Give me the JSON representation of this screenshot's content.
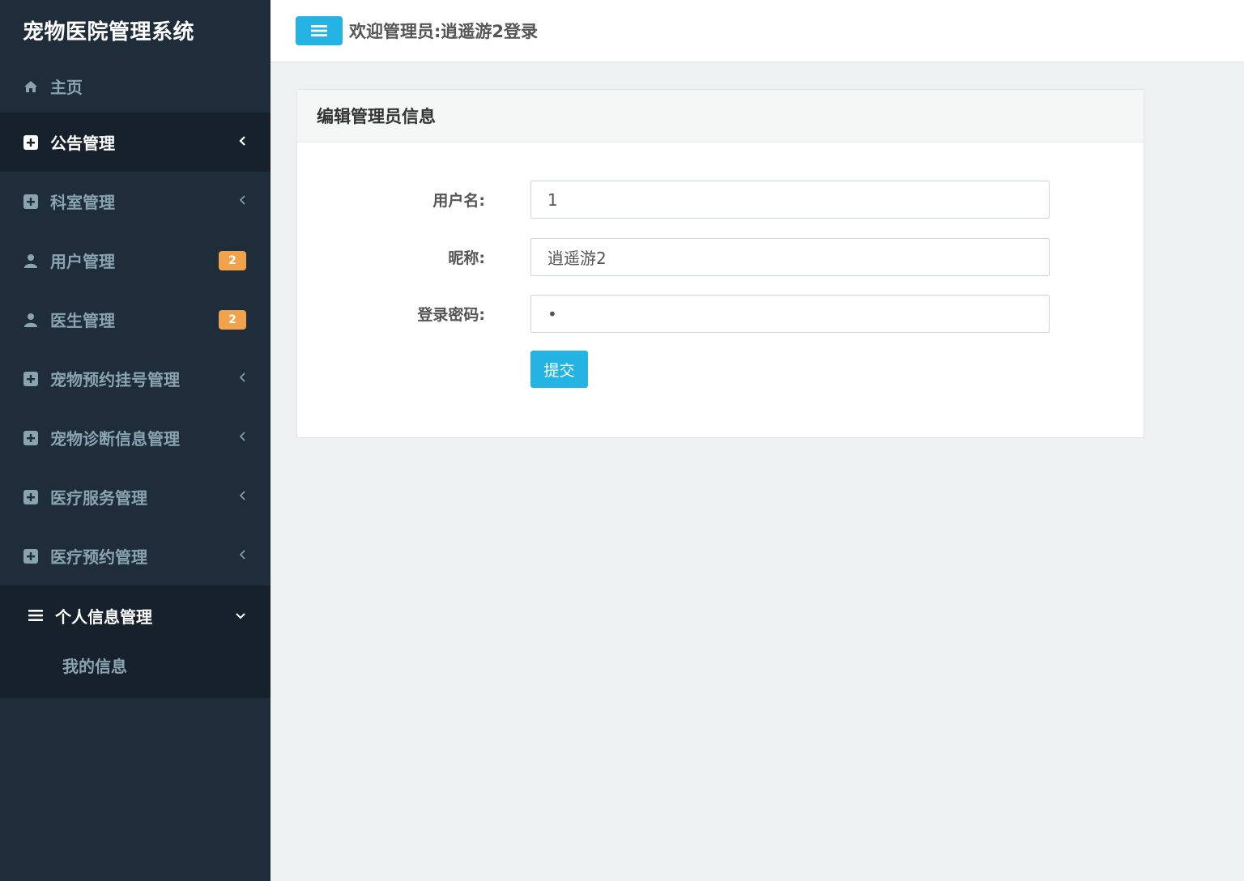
{
  "app": {
    "title": "宠物医院管理系统"
  },
  "sidebar": {
    "items": [
      {
        "label": "主页",
        "icon": "home-icon"
      },
      {
        "label": "公告管理",
        "icon": "plus-square-icon",
        "active": true
      },
      {
        "label": "科室管理",
        "icon": "plus-square-icon"
      },
      {
        "label": "用户管理",
        "icon": "user-icon",
        "badge": "2"
      },
      {
        "label": "医生管理",
        "icon": "user-icon",
        "badge": "2"
      },
      {
        "label": "宠物预约挂号管理",
        "icon": "plus-square-icon"
      },
      {
        "label": "宠物诊断信息管理",
        "icon": "plus-square-icon"
      },
      {
        "label": "医疗服务管理",
        "icon": "plus-square-icon"
      },
      {
        "label": "医疗预约管理",
        "icon": "plus-square-icon"
      },
      {
        "label": "个人信息管理",
        "icon": "bars-icon",
        "expanded": true
      }
    ],
    "submenu": [
      {
        "label": "我的信息"
      }
    ]
  },
  "header": {
    "welcome": "欢迎管理员:逍遥游2登录"
  },
  "panel": {
    "title": "编辑管理员信息",
    "fields": [
      {
        "label": "用户名:",
        "value": "1"
      },
      {
        "label": "昵称:",
        "value": "逍遥游2"
      },
      {
        "label": "登录密码:",
        "value": "•"
      }
    ],
    "submit_label": "提交"
  },
  "colors": {
    "sidebar_bg": "#1f2d3a",
    "sidebar_active_bg": "#16212b",
    "accent": "#25b3e3",
    "badge": "#f0a34a"
  }
}
